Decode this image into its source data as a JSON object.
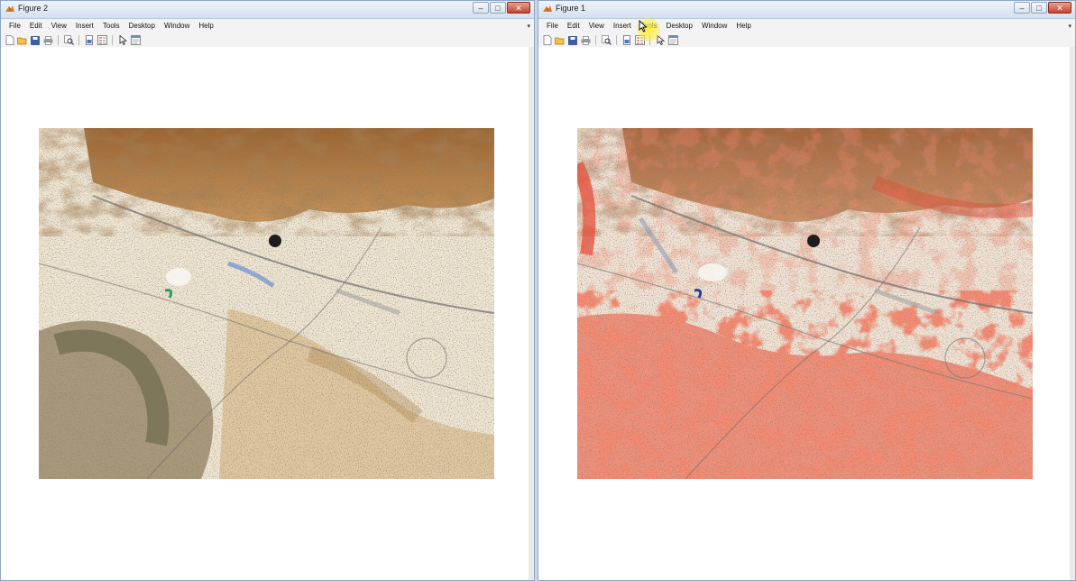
{
  "windows": [
    {
      "title": "Figure 2",
      "menus": [
        "File",
        "Edit",
        "View",
        "Insert",
        "Tools",
        "Desktop",
        "Window",
        "Help"
      ],
      "controls": {
        "minimize": "–",
        "maximize": "□",
        "close": "✕"
      },
      "image_type": "true-color"
    },
    {
      "title": "Figure 1",
      "menus": [
        "File",
        "Edit",
        "View",
        "Insert",
        "Tools",
        "Desktop",
        "Window",
        "Help"
      ],
      "controls": {
        "minimize": "–",
        "maximize": "□",
        "close": "✕"
      },
      "image_type": "false-color"
    }
  ],
  "toolbar_icons": [
    "new-figure-icon",
    "open-file-icon",
    "save-icon",
    "print-icon",
    "print-preview-icon",
    "link-plot-icon",
    "insert-legend-icon",
    "edit-plot-icon",
    "property-editor-icon"
  ],
  "colors": {
    "titlebar": "#d5e1ee",
    "menubar": "#f3f3f3",
    "vegetation_false_color": "#e8402c",
    "terrain": "#b57a3c",
    "urban": "#efe8da",
    "cursor_highlight": "#ffee28"
  }
}
